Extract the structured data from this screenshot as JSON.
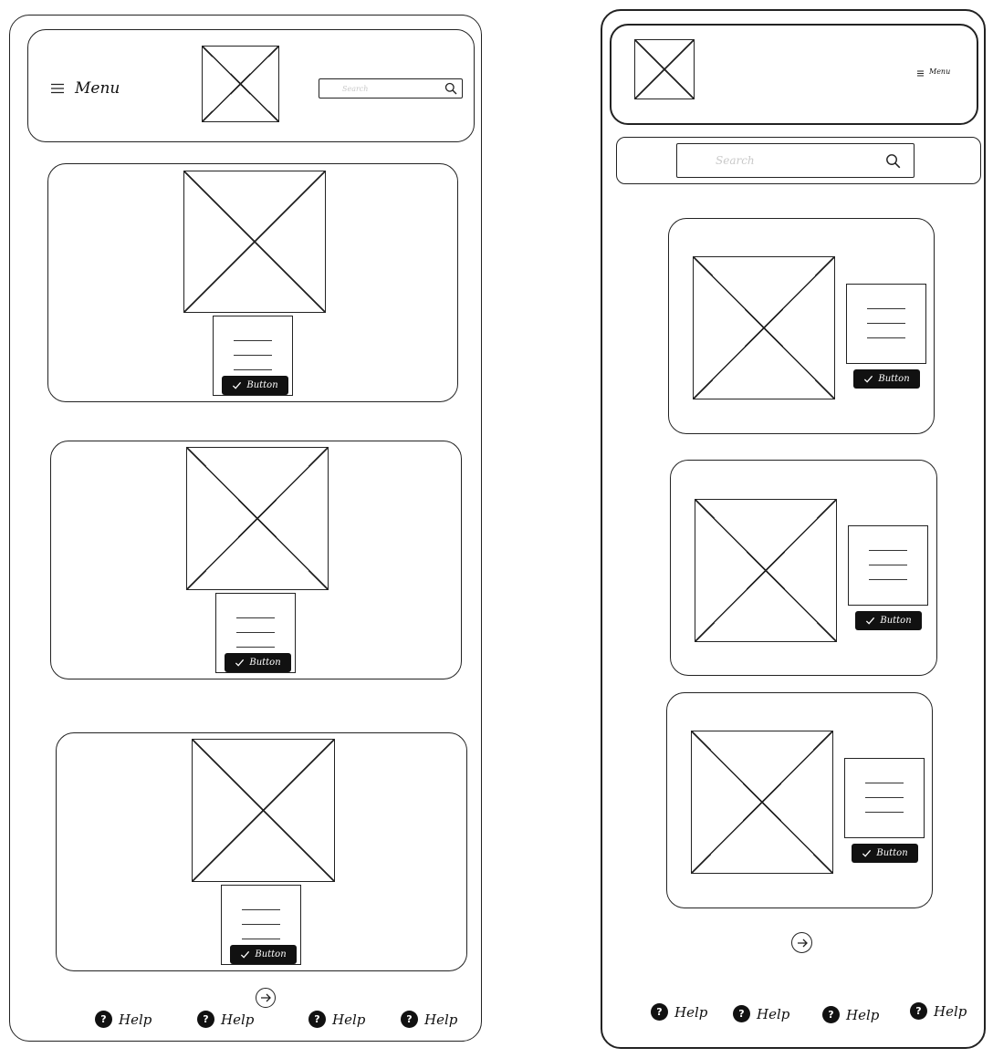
{
  "mobile": {
    "header": {
      "menu_label": "Menu",
      "search_placeholder": "Search"
    },
    "cards": [
      {
        "button_label": "Button"
      },
      {
        "button_label": "Button"
      },
      {
        "button_label": "Button"
      }
    ],
    "footer": {
      "help_links": [
        "Help",
        "Help",
        "Help",
        "Help"
      ]
    }
  },
  "tablet": {
    "header": {
      "menu_label": "Menu"
    },
    "search_placeholder": "Search",
    "cards": [
      {
        "button_label": "Button"
      },
      {
        "button_label": "Button"
      },
      {
        "button_label": "Button"
      }
    ],
    "footer": {
      "help_links": [
        "Help",
        "Help",
        "Help",
        "Help"
      ]
    }
  },
  "colors": {
    "ink": "#1e1e1e",
    "button_fill": "#111111",
    "placeholder_text": "#c9c9c9",
    "background": "#ffffff"
  },
  "icons": [
    "hamburger-icon",
    "search-icon",
    "check-icon",
    "arrow-right-icon",
    "help-icon"
  ]
}
